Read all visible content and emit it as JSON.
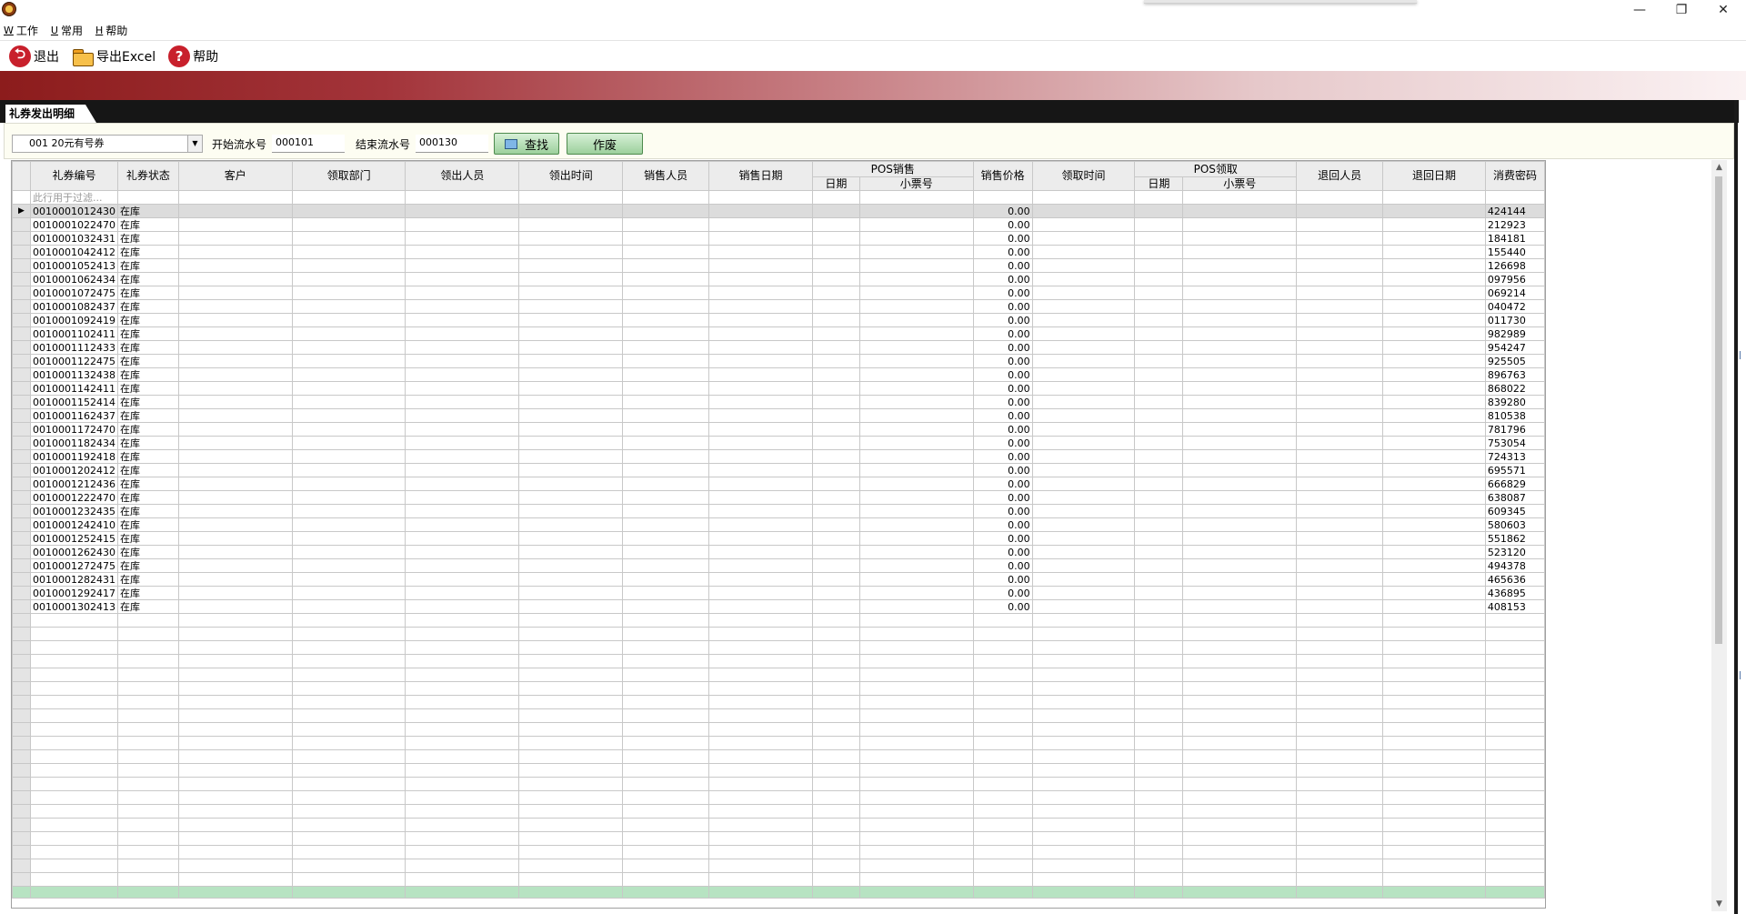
{
  "window": {
    "controls": {
      "minimize": "—",
      "restore": "❐",
      "close": "✕"
    }
  },
  "menu": [
    {
      "accel": "W",
      "label": "工作"
    },
    {
      "accel": "U",
      "label": "常用"
    },
    {
      "accel": "H",
      "label": "帮助"
    }
  ],
  "toolbar": {
    "exit_label": "退出",
    "export_label": "导出Excel",
    "help_label": "帮助"
  },
  "tab": {
    "label": "礼券发出明细"
  },
  "filter": {
    "coupon_type": "001 20元有号券",
    "start_label": "开始流水号",
    "start_value": "000101",
    "end_label": "结束流水号",
    "end_value": "000130",
    "search_label": "查找",
    "void_label": "作废"
  },
  "grid": {
    "columns_top": [
      {
        "label": "礼券编号",
        "key": "id"
      },
      {
        "label": "礼券状态",
        "key": "status"
      },
      {
        "label": "客户",
        "key": "customer"
      },
      {
        "label": "领取部门",
        "key": "dept"
      },
      {
        "label": "领出人员",
        "key": "issuer"
      },
      {
        "label": "领出时间",
        "key": "issue_time"
      },
      {
        "label": "销售人员",
        "key": "seller"
      },
      {
        "label": "销售日期",
        "key": "sale_date"
      },
      {
        "label": "POS销售",
        "group": true
      },
      {
        "label": "销售价格",
        "key": "price"
      },
      {
        "label": "领取时间",
        "key": "recv_time"
      },
      {
        "label": "POS领取",
        "group": true
      },
      {
        "label": "退回人员",
        "key": "returner"
      },
      {
        "label": "退回日期",
        "key": "return_date"
      },
      {
        "label": "消费密码",
        "key": "password"
      }
    ],
    "pos_sale_sub": [
      "日期",
      "小票号"
    ],
    "pos_recv_sub": [
      "日期",
      "小票号"
    ],
    "filter_hint": "此行用于过滤...",
    "rows": [
      {
        "id": "0010001012430",
        "status": "在库",
        "price": "0.00",
        "password": "424144"
      },
      {
        "id": "0010001022470",
        "status": "在库",
        "price": "0.00",
        "password": "212923"
      },
      {
        "id": "0010001032431",
        "status": "在库",
        "price": "0.00",
        "password": "184181"
      },
      {
        "id": "0010001042412",
        "status": "在库",
        "price": "0.00",
        "password": "155440"
      },
      {
        "id": "0010001052413",
        "status": "在库",
        "price": "0.00",
        "password": "126698"
      },
      {
        "id": "0010001062434",
        "status": "在库",
        "price": "0.00",
        "password": "097956"
      },
      {
        "id": "0010001072475",
        "status": "在库",
        "price": "0.00",
        "password": "069214"
      },
      {
        "id": "0010001082437",
        "status": "在库",
        "price": "0.00",
        "password": "040472"
      },
      {
        "id": "0010001092419",
        "status": "在库",
        "price": "0.00",
        "password": "011730"
      },
      {
        "id": "0010001102411",
        "status": "在库",
        "price": "0.00",
        "password": "982989"
      },
      {
        "id": "0010001112433",
        "status": "在库",
        "price": "0.00",
        "password": "954247"
      },
      {
        "id": "0010001122475",
        "status": "在库",
        "price": "0.00",
        "password": "925505"
      },
      {
        "id": "0010001132438",
        "status": "在库",
        "price": "0.00",
        "password": "896763"
      },
      {
        "id": "0010001142411",
        "status": "在库",
        "price": "0.00",
        "password": "868022"
      },
      {
        "id": "0010001152414",
        "status": "在库",
        "price": "0.00",
        "password": "839280"
      },
      {
        "id": "0010001162437",
        "status": "在库",
        "price": "0.00",
        "password": "810538"
      },
      {
        "id": "0010001172470",
        "status": "在库",
        "price": "0.00",
        "password": "781796"
      },
      {
        "id": "0010001182434",
        "status": "在库",
        "price": "0.00",
        "password": "753054"
      },
      {
        "id": "0010001192418",
        "status": "在库",
        "price": "0.00",
        "password": "724313"
      },
      {
        "id": "0010001202412",
        "status": "在库",
        "price": "0.00",
        "password": "695571"
      },
      {
        "id": "0010001212436",
        "status": "在库",
        "price": "0.00",
        "password": "666829"
      },
      {
        "id": "0010001222470",
        "status": "在库",
        "price": "0.00",
        "password": "638087"
      },
      {
        "id": "0010001232435",
        "status": "在库",
        "price": "0.00",
        "password": "609345"
      },
      {
        "id": "0010001242410",
        "status": "在库",
        "price": "0.00",
        "password": "580603"
      },
      {
        "id": "0010001252415",
        "status": "在库",
        "price": "0.00",
        "password": "551862"
      },
      {
        "id": "0010001262430",
        "status": "在库",
        "price": "0.00",
        "password": "523120"
      },
      {
        "id": "0010001272475",
        "status": "在库",
        "price": "0.00",
        "password": "494378"
      },
      {
        "id": "0010001282431",
        "status": "在库",
        "price": "0.00",
        "password": "465636"
      },
      {
        "id": "0010001292417",
        "status": "在库",
        "price": "0.00",
        "password": "436895"
      },
      {
        "id": "0010001302413",
        "status": "在库",
        "price": "0.00",
        "password": "408153"
      }
    ],
    "selected_row": 0,
    "row_marker": "▶"
  },
  "colors": {
    "banner_start": "#8c1c1c",
    "banner_end": "#fbf2f3",
    "summary_row": "#b7e3c2",
    "filter_panel": "#fdfdf2"
  }
}
